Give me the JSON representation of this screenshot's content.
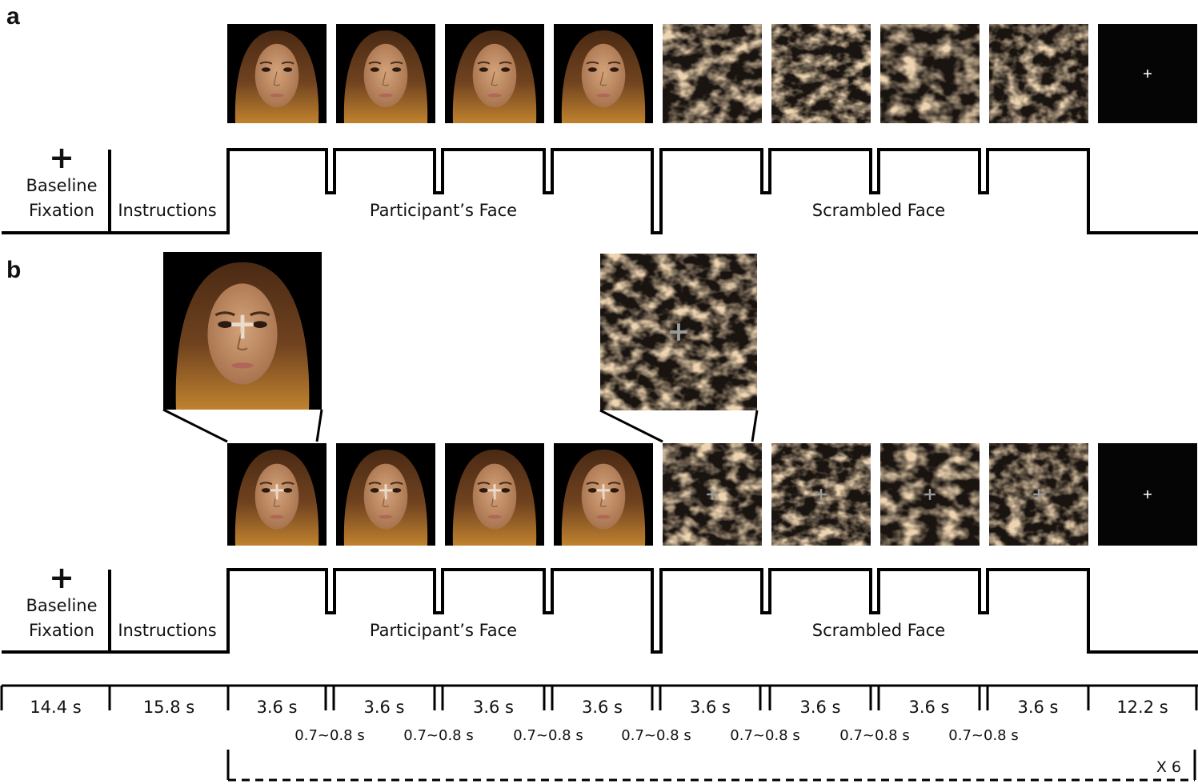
{
  "figure": {
    "type": "experimental-paradigm-timeline",
    "panels": [
      {
        "label": "a",
        "stimuli": [
          {
            "kind": "face",
            "cross": false
          },
          {
            "kind": "face",
            "cross": false
          },
          {
            "kind": "face",
            "cross": false
          },
          {
            "kind": "face",
            "cross": false
          },
          {
            "kind": "scrambled",
            "cross": false
          },
          {
            "kind": "scrambled",
            "cross": false
          },
          {
            "kind": "scrambled",
            "cross": false
          },
          {
            "kind": "scrambled",
            "cross": false
          },
          {
            "kind": "fixation",
            "cross": true
          }
        ],
        "blocks": {
          "fixation_symbol": "+",
          "baseline_line1": "Baseline",
          "baseline_line2": "Fixation",
          "instructions": "Instructions",
          "participant_face": "Participant’s Face",
          "scrambled_face": "Scrambled Face"
        }
      },
      {
        "label": "b",
        "stimuli": [
          {
            "kind": "face",
            "cross": true
          },
          {
            "kind": "face",
            "cross": true
          },
          {
            "kind": "face",
            "cross": true
          },
          {
            "kind": "face",
            "cross": true
          },
          {
            "kind": "scrambled",
            "cross": true
          },
          {
            "kind": "scrambled",
            "cross": true
          },
          {
            "kind": "scrambled",
            "cross": true
          },
          {
            "kind": "scrambled",
            "cross": true
          },
          {
            "kind": "fixation",
            "cross": true
          }
        ],
        "zoom_insets": [
          {
            "of_stimulus_index": 0,
            "kind": "face",
            "cross": true
          },
          {
            "of_stimulus_index": 4,
            "kind": "scrambled",
            "cross": true
          }
        ],
        "blocks": {
          "fixation_symbol": "+",
          "baseline_line1": "Baseline",
          "baseline_line2": "Fixation",
          "instructions": "Instructions",
          "participant_face": "Participant’s Face",
          "scrambled_face": "Scrambled Face"
        }
      }
    ],
    "timeline": {
      "durations": [
        "14.4 s",
        "15.8 s",
        "3.6 s",
        "3.6 s",
        "3.6 s",
        "3.6 s",
        "3.6 s",
        "3.6 s",
        "3.6 s",
        "3.6 s",
        "12.2 s"
      ],
      "gaps": [
        "0.7~0.8 s",
        "0.7~0.8 s",
        "0.7~0.8 s",
        "0.7~0.8 s",
        "0.7~0.8 s",
        "0.7~0.8 s",
        "0.7~0.8 s"
      ],
      "repeat_label": "X 6"
    },
    "colors": {
      "line": "#000000",
      "stimulus_bg": "#000000",
      "hair": "#6b3f1f",
      "skin": "#c89670",
      "scramble_light": "#d9aa72",
      "scramble_dark": "#1a1410"
    }
  }
}
